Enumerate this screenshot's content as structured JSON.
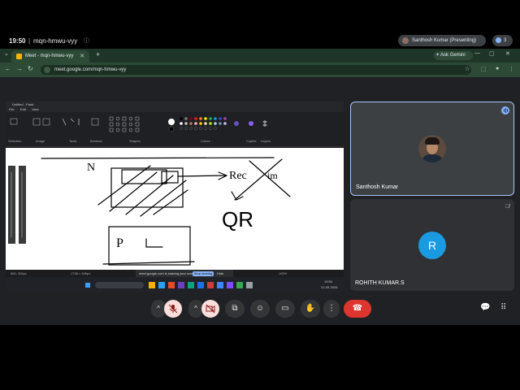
{
  "browser": {
    "tab_title": "Meet - mqn-hmwu-vyy",
    "tab_close": "✕",
    "new_tab": "+",
    "tab_menu": "⌄",
    "ask_gemini": "Ask Gemini",
    "url": "meet.google.com/mqn-hmwu-vyy",
    "win_min": "—",
    "win_max": "▢",
    "win_close": "✕"
  },
  "meet": {
    "time": "19:50",
    "separator": "|",
    "code": "mqn-hmwu-vyy",
    "presenting_label": "Santhosh Kumar (Presenting)",
    "participant_count": "3"
  },
  "presentation": {
    "window_title": "Untitled - Paint",
    "menu_file": "File",
    "menu_edit": "Edit",
    "menu_view": "View",
    "ribbon_labels": [
      "Selection",
      "Image",
      "Tools",
      "Brushes",
      "Shapes",
      "Colors",
      "Copilot",
      "Layers"
    ],
    "status_left": "860, 306px",
    "status_dims": "1736 × 946px",
    "status_zoom": "100%",
    "share_banner_text": "meet.google.com is sharing your screen",
    "stop_sharing": "Stop sharing",
    "hide": "Hide",
    "tray_time": "19:50",
    "tray_date": "21-09-2025",
    "sketch_text": {
      "n": "N",
      "rec": "Rec",
      "im": "im",
      "qr": "QR",
      "p": "P",
      "l": "L"
    }
  },
  "participants": [
    {
      "name": "Santhosh Kumar"
    },
    {
      "name": "ROHITH KUMAR.S",
      "initial": "R"
    }
  ],
  "colors": {
    "accent": "#8ab4f8",
    "hangup": "#dc362e",
    "muted_bg": "#f9dedc",
    "avatar_blue": "#1a9ae0"
  },
  "icons": {
    "mic": "mic-off-icon",
    "camera": "video-off-icon",
    "present": "present-icon",
    "emoji": "emoji-icon",
    "captions": "captions-icon",
    "hand": "raise-hand-icon",
    "more": "more-vert-icon",
    "hangup": "call-end-icon",
    "chat": "chat-icon",
    "activities": "apps-icon"
  }
}
